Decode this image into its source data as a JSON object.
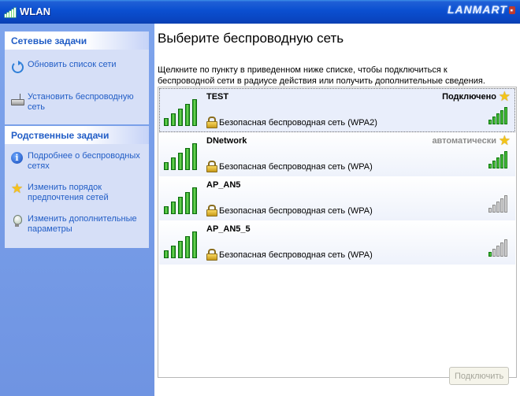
{
  "window": {
    "title": "WLAN",
    "logo_text": "LANMART"
  },
  "sidebar": {
    "network_tasks": {
      "header": "Сетевые задачи",
      "items": [
        {
          "icon": "refresh-icon",
          "label": "Обновить список сети"
        },
        {
          "icon": "router-icon",
          "label": "Установить беспроводную сеть"
        }
      ]
    },
    "related_tasks": {
      "header": "Родственные задачи",
      "items": [
        {
          "icon": "info-icon",
          "label": "Подробнее о беспроводных сетях"
        },
        {
          "icon": "star-icon",
          "label": "Изменить порядок предпочтения  сетей"
        },
        {
          "icon": "bulb-icon",
          "label": "Изменить дополнительные параметры"
        }
      ]
    }
  },
  "main": {
    "heading": "Выберите беспроводную сеть",
    "description": "Щелкните по пункту в приведенном ниже списке, чтобы подключиться к беспроводной сети в радиусе действия или получить дополнительные сведения.",
    "networks": [
      {
        "name": "TEST",
        "security": "Безопасная беспроводная сеть (WPA2)",
        "status": "Подключено",
        "favorite": true,
        "signal_bars": 5,
        "selected": true
      },
      {
        "name": "DNetwork",
        "security": "Безопасная беспроводная сеть (WPA)",
        "status": "автоматически",
        "favorite": true,
        "signal_bars": 5,
        "selected": false
      },
      {
        "name": "AP_AN5",
        "security": "Безопасная беспроводная сеть (WPA)",
        "status": "",
        "favorite": false,
        "signal_bars": 0,
        "selected": false
      },
      {
        "name": "AP_AN5_5",
        "security": "Безопасная беспроводная сеть (WPA)",
        "status": "",
        "favorite": false,
        "signal_bars": 1,
        "selected": false
      }
    ],
    "connect_label": "Подключить"
  },
  "colors": {
    "title_bar": "#0b4fd0",
    "sidebar_bg": "#7ea4ec",
    "task_link": "#215dc6",
    "signal_green": "#17a017"
  }
}
